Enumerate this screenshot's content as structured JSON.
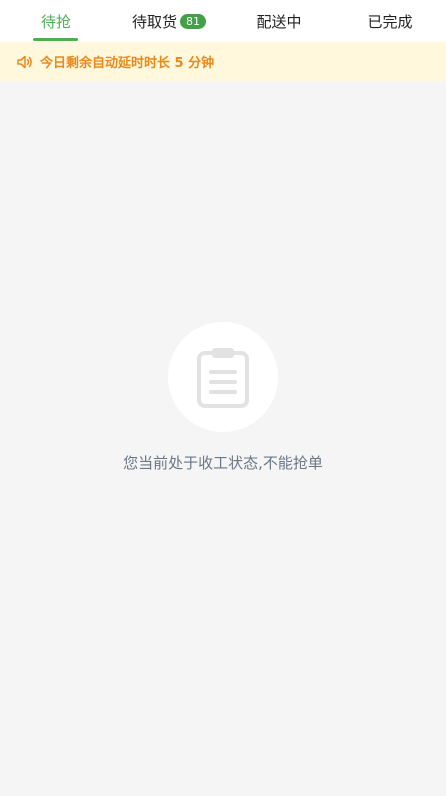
{
  "tabs": [
    {
      "label": "待抢",
      "active": true
    },
    {
      "label": "待取货",
      "badge": "81",
      "active": false
    },
    {
      "label": "配送中",
      "active": false
    },
    {
      "label": "已完成",
      "active": false
    }
  ],
  "notice": {
    "text": "今日剩余自动延时时长 5 分钟",
    "color": "#e8891c"
  },
  "empty_state": {
    "icon": "clipboard-icon",
    "message": "您当前处于收工状态,不能抢单"
  },
  "colors": {
    "accent": "#4caf50",
    "background": "#f5f5f5",
    "notice_bg": "#fff8dc"
  }
}
